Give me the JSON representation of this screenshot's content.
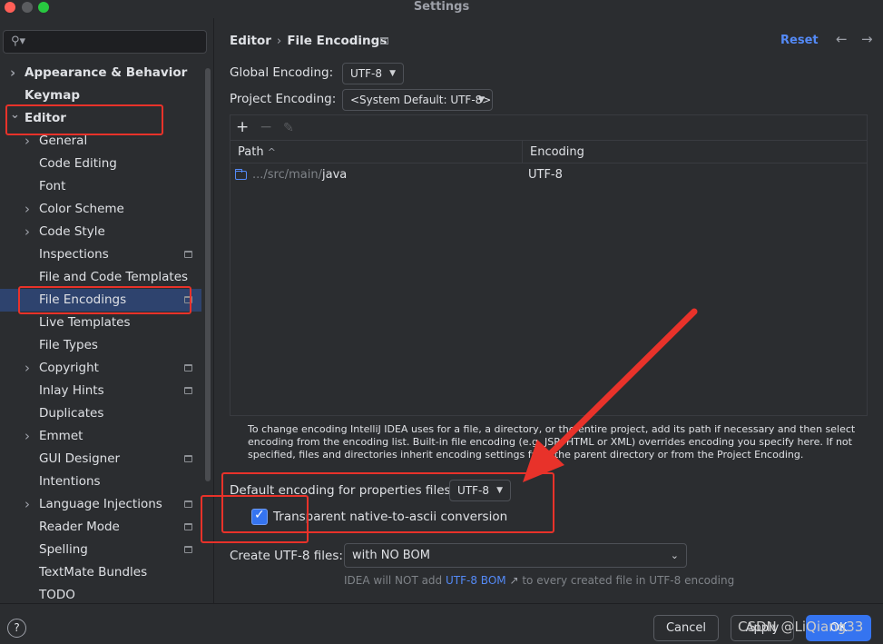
{
  "window": {
    "title": "Settings"
  },
  "search": {
    "placeholder": ""
  },
  "sidebar": {
    "items": [
      {
        "label": "Appearance & Behavior",
        "level": 0,
        "chevron": "right",
        "bold": true
      },
      {
        "label": "Keymap",
        "level": 0,
        "chevron": "",
        "bold": true
      },
      {
        "label": "Editor",
        "level": 0,
        "chevron": "down",
        "bold": true
      },
      {
        "label": "General",
        "level": 1,
        "chevron": "right"
      },
      {
        "label": "Code Editing",
        "level": 1,
        "chevron": ""
      },
      {
        "label": "Font",
        "level": 1,
        "chevron": ""
      },
      {
        "label": "Color Scheme",
        "level": 1,
        "chevron": "right"
      },
      {
        "label": "Code Style",
        "level": 1,
        "chevron": "right"
      },
      {
        "label": "Inspections",
        "level": 1,
        "chevron": "",
        "project_icon": true
      },
      {
        "label": "File and Code Templates",
        "level": 1,
        "chevron": ""
      },
      {
        "label": "File Encodings",
        "level": 1,
        "chevron": "",
        "project_icon": true,
        "selected": true
      },
      {
        "label": "Live Templates",
        "level": 1,
        "chevron": ""
      },
      {
        "label": "File Types",
        "level": 1,
        "chevron": ""
      },
      {
        "label": "Copyright",
        "level": 1,
        "chevron": "right",
        "project_icon": true
      },
      {
        "label": "Inlay Hints",
        "level": 1,
        "chevron": "",
        "project_icon": true
      },
      {
        "label": "Duplicates",
        "level": 1,
        "chevron": ""
      },
      {
        "label": "Emmet",
        "level": 1,
        "chevron": "right"
      },
      {
        "label": "GUI Designer",
        "level": 1,
        "chevron": "",
        "project_icon": true
      },
      {
        "label": "Intentions",
        "level": 1,
        "chevron": ""
      },
      {
        "label": "Language Injections",
        "level": 1,
        "chevron": "right",
        "project_icon": true
      },
      {
        "label": "Reader Mode",
        "level": 1,
        "chevron": "",
        "project_icon": true
      },
      {
        "label": "Spelling",
        "level": 1,
        "chevron": "",
        "project_icon": true
      },
      {
        "label": "TextMate Bundles",
        "level": 1,
        "chevron": ""
      },
      {
        "label": "TODO",
        "level": 1,
        "chevron": ""
      }
    ]
  },
  "header": {
    "breadcrumb_parent": "Editor",
    "breadcrumb_sep": "›",
    "breadcrumb_current": "File Encodings",
    "reset_label": "Reset",
    "back_arrow": "←",
    "forward_arrow": "→"
  },
  "encodings": {
    "global_label": "Global Encoding:",
    "global_value": "UTF-8",
    "project_label": "Project Encoding:",
    "project_value": "<System Default: UTF-8>"
  },
  "table": {
    "toolbar": {
      "add": "+",
      "remove": "−",
      "edit": "✎"
    },
    "columns": {
      "path": "Path",
      "sort_indicator": "^",
      "encoding": "Encoding"
    },
    "rows": [
      {
        "path_prefix": ".../src/main/",
        "path_name": "java",
        "encoding": "UTF-8"
      }
    ]
  },
  "hint_text": "To change encoding IntelliJ IDEA uses for a file, a directory, or the entire project, add its path if necessary and then select encoding from the encoding list. Built-in file encoding (e.g. JSP, HTML or XML) overrides encoding you specify here. If not specified, files and directories inherit encoding settings from the parent directory or from the Project Encoding.",
  "properties": {
    "default_label": "Default encoding for properties files:",
    "default_value": "UTF-8",
    "transparent_label": "Transparent native-to-ascii conversion",
    "transparent_checked": true
  },
  "bom": {
    "label": "Create UTF-8 files:",
    "value": "with NO BOM",
    "hint_prefix": "IDEA will NOT add",
    "hint_link": "UTF-8 BOM",
    "hint_link_icon": "↗",
    "hint_suffix": "to every created file in UTF-8 encoding"
  },
  "footer": {
    "help": "?",
    "cancel": "Cancel",
    "apply": "Apply",
    "ok": "OK",
    "watermark": "CSDN @LiQiang33"
  },
  "colors": {
    "annotation_red": "#e8322a",
    "accent_blue": "#3574f0",
    "link_blue": "#548af7",
    "selection": "#2e436e"
  }
}
